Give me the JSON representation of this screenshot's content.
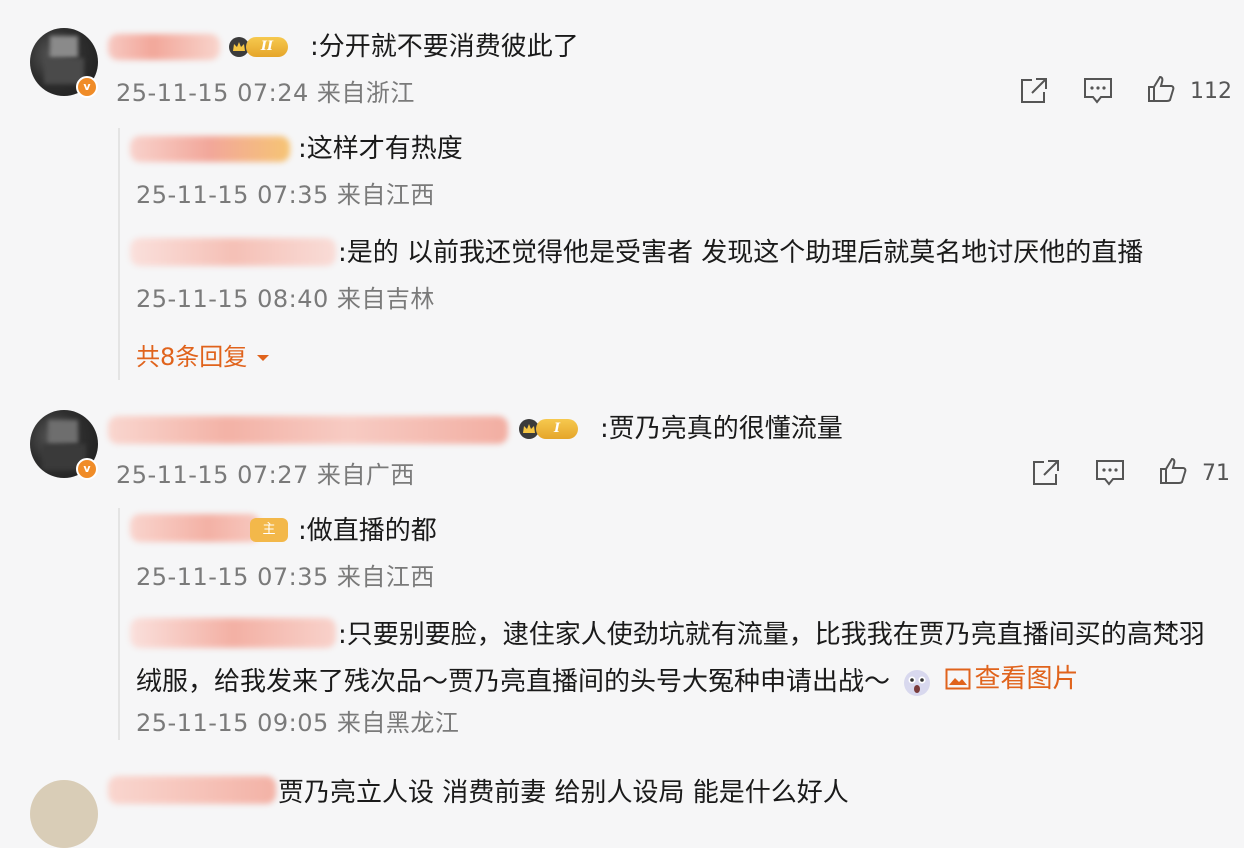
{
  "comments": [
    {
      "text": ":分开就不要消费彼此了",
      "level": "II",
      "meta": "25-11-15 07:24 来自浙江",
      "likes": "112",
      "replies": [
        {
          "text": ":这样才有热度",
          "meta": "25-11-15 07:35 来自江西"
        },
        {
          "text": ":是的 以前我还觉得他是受害者 发现这个助理后就莫名地讨厌他的直播",
          "meta": "25-11-15 08:40 来自吉林"
        }
      ],
      "more_label": "共8条回复"
    },
    {
      "text": ":贾乃亮真的很懂流量",
      "level": "I",
      "meta": "25-11-15 07:27 来自广西",
      "likes": "71",
      "replies": [
        {
          "text": ":做直播的都",
          "badge": "主",
          "meta": "25-11-15 07:35 来自江西"
        },
        {
          "text_line1": ":只要别要脸，逮住家人使劲坑就有流量，比我我在贾乃亮直播间买的高梵羽",
          "text_line2": "绒服，给我发来了残次品～贾乃亮直播间的头号大冤种申请出战～",
          "view_image": "查看图片",
          "meta": "25-11-15 09:05 来自黑龙江"
        }
      ]
    },
    {
      "text": "贾乃亮立人设 消费前妻 给别人设局 能是什么好人"
    }
  ],
  "colors": {
    "accent": "#e0631c",
    "meta": "#7a7a7a",
    "badge": "#f08c28",
    "crown": "#e5a52a"
  },
  "icons": [
    "share-icon",
    "comment-icon",
    "like-icon",
    "crown-icon",
    "verified-badge",
    "image-icon",
    "emoji-icon",
    "chevron-down-icon"
  ]
}
